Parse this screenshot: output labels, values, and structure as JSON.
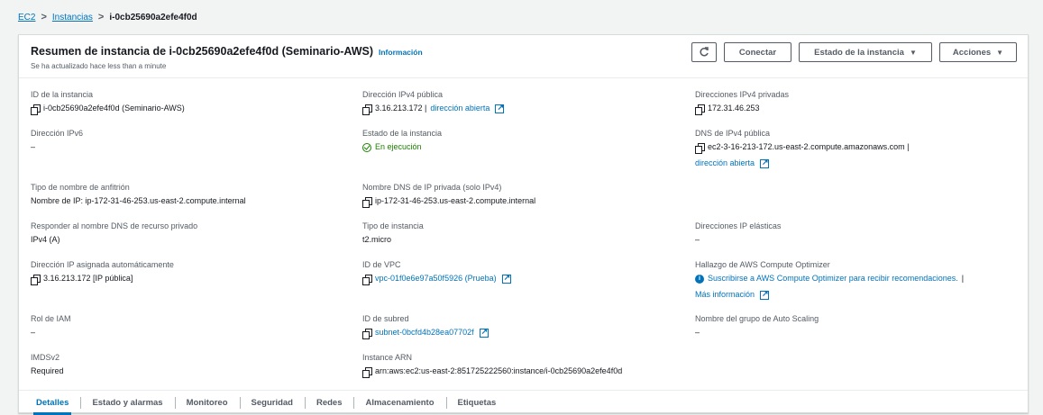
{
  "breadcrumb": {
    "root": "EC2",
    "section": "Instancias",
    "current": "i-0cb25690a2efe4f0d"
  },
  "header": {
    "title": "Resumen de instancia de i-0cb25690a2efe4f0d (Seminario-AWS)",
    "info_link": "Información",
    "subtitle": "Se ha actualizado hace less than a minute",
    "refresh_icon": "refresh-icon",
    "connect_label": "Conectar",
    "state_label": "Estado de la instancia",
    "actions_label": "Acciones"
  },
  "details": {
    "instance_id": {
      "label": "ID de la instancia",
      "value": "i-0cb25690a2efe4f0d (Seminario-AWS)"
    },
    "public_ipv4": {
      "label": "Dirección IPv4 pública",
      "value": "3.16.213.172 |",
      "link": "dirección abierta"
    },
    "private_ipv4": {
      "label": "Direcciones IPv4 privadas",
      "value": "172.31.46.253"
    },
    "ipv6": {
      "label": "Dirección IPv6",
      "value": "–"
    },
    "instance_state": {
      "label": "Estado de la instancia",
      "value": "En ejecución"
    },
    "public_dns": {
      "label": "DNS de IPv4 pública",
      "value": "ec2-3-16-213-172.us-east-2.compute.amazonaws.com |",
      "link": "dirección abierta"
    },
    "hostname_type": {
      "label": "Tipo de nombre de anfitrión",
      "value": "Nombre de IP: ip-172-31-46-253.us-east-2.compute.internal"
    },
    "private_dns": {
      "label": "Nombre DNS de IP privada (solo IPv4)",
      "value": "ip-172-31-46-253.us-east-2.compute.internal"
    },
    "resource_dns": {
      "label": "Responder al nombre DNS de recurso privado",
      "value": "IPv4 (A)"
    },
    "instance_type": {
      "label": "Tipo de instancia",
      "value": "t2.micro"
    },
    "elastic_ip": {
      "label": "Direcciones IP elásticas",
      "value": "–"
    },
    "auto_ip": {
      "label": "Dirección IP asignada automáticamente",
      "value": "3.16.213.172 [IP pública]"
    },
    "vpc_id": {
      "label": "ID de VPC",
      "value": "vpc-01f0e6e97a50f5926 (Prueba)"
    },
    "optimizer": {
      "label": "Hallazgo de AWS Compute Optimizer",
      "value": "Suscribirse a AWS Compute Optimizer para recibir recomendaciones.",
      "sep": "|",
      "link": "Más información"
    },
    "iam_role": {
      "label": "Rol de IAM",
      "value": "–"
    },
    "subnet_id": {
      "label": "ID de subred",
      "value": "subnet-0bcfd4b28ea07702f"
    },
    "asg_name": {
      "label": "Nombre del grupo de Auto Scaling",
      "value": "–"
    },
    "imdsv2": {
      "label": "IMDSv2",
      "value": "Required"
    },
    "instance_arn": {
      "label": "Instance ARN",
      "value": "arn:aws:ec2:us-east-2:851725222560:instance/i-0cb25690a2efe4f0d"
    }
  },
  "tabs": [
    "Detalles",
    "Estado y alarmas",
    "Monitoreo",
    "Seguridad",
    "Redes",
    "Almacenamiento",
    "Etiquetas"
  ],
  "colors": {
    "link": "#0073bb",
    "success": "#1d8102",
    "text": "#16191f",
    "muted": "#545b64"
  }
}
